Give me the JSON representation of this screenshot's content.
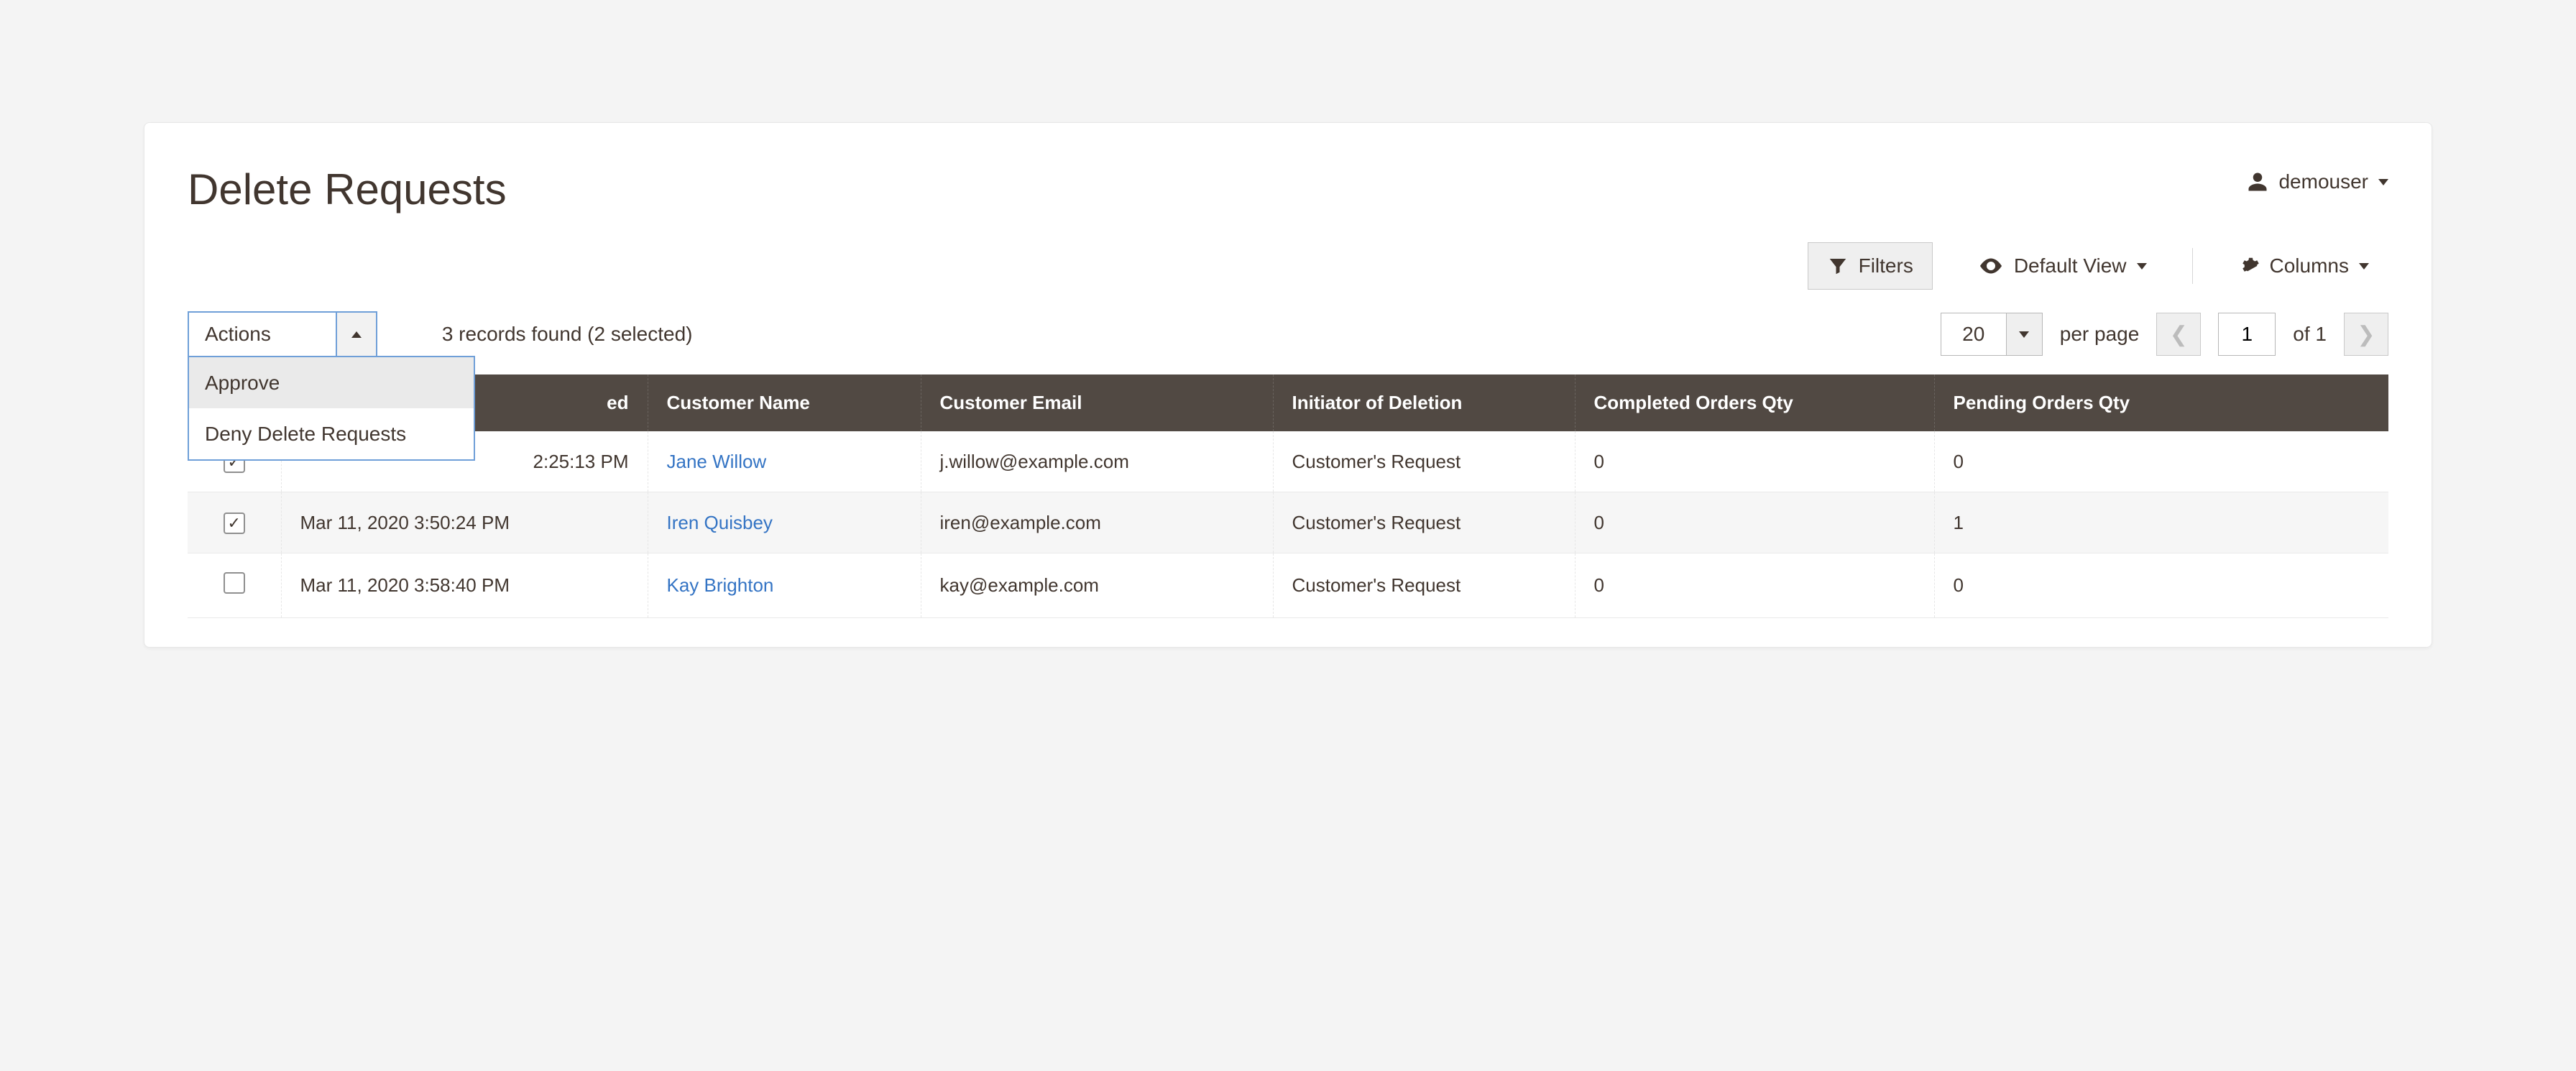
{
  "page": {
    "title": "Delete Requests"
  },
  "user": {
    "name": "demouser"
  },
  "toolbar": {
    "filters_label": "Filters",
    "default_view_label": "Default View",
    "columns_label": "Columns"
  },
  "actions": {
    "button_label": "Actions",
    "options": [
      "Approve",
      "Deny Delete Requests"
    ]
  },
  "records_found_text": "3 records found (2 selected)",
  "pagination": {
    "page_size": "20",
    "per_page_label": "per page",
    "current_page": "1",
    "total_pages_label": "of 1"
  },
  "columns": {
    "date_fragment": "ed",
    "customer_name": "Customer Name",
    "customer_email": "Customer Email",
    "initiator": "Initiator of Deletion",
    "completed_qty": "Completed Orders Qty",
    "pending_qty": "Pending Orders Qty"
  },
  "rows": [
    {
      "checked": true,
      "date_fragment": "2:25:13 PM",
      "name": "Jane Willow",
      "email": "j.willow@example.com",
      "initiator": "Customer's Request",
      "completed": "0",
      "pending": "0"
    },
    {
      "checked": true,
      "date": "Mar 11, 2020 3:50:24 PM",
      "name": "Iren Quisbey",
      "email": "iren@example.com",
      "initiator": "Customer's Request",
      "completed": "0",
      "pending": "1"
    },
    {
      "checked": false,
      "date": "Mar 11, 2020 3:58:40 PM",
      "name": "Kay Brighton",
      "email": "kay@example.com",
      "initiator": "Customer's Request",
      "completed": "0",
      "pending": "0"
    }
  ]
}
